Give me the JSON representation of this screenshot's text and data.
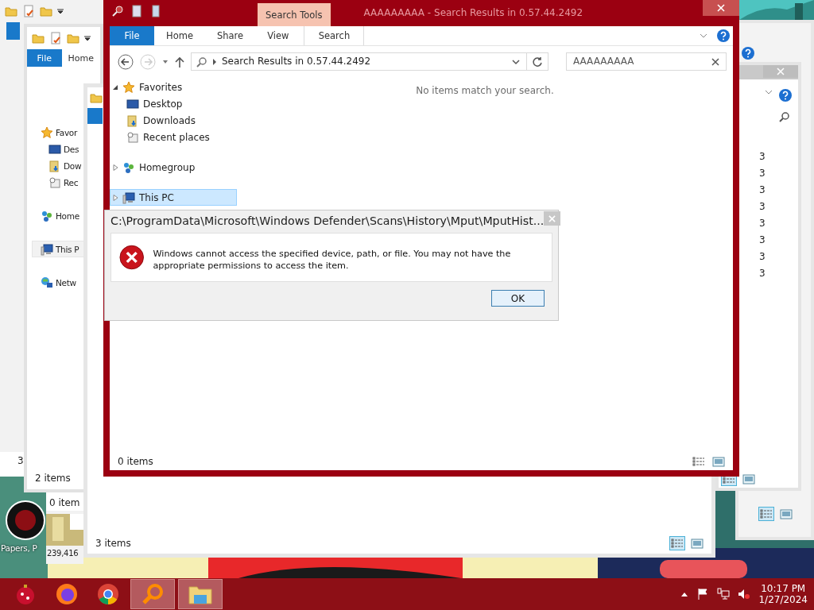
{
  "desktop": {
    "icon_label": "Papers, P"
  },
  "window_left": {
    "column_value": "3"
  },
  "window_behind": {
    "tabs": [
      {
        "label": "File",
        "selected": false
      },
      {
        "label": "Home",
        "selected": false
      }
    ],
    "nav_items": [
      {
        "label": "Favor",
        "kind": "favorites",
        "selected": false
      },
      {
        "label": "Des",
        "kind": "desktop",
        "selected": false
      },
      {
        "label": "Dow",
        "kind": "downloads",
        "selected": false
      },
      {
        "label": "Rec",
        "kind": "recent",
        "selected": false
      },
      {
        "label": "Home",
        "kind": "homegroup",
        "selected": false
      },
      {
        "label": "This P",
        "kind": "pc",
        "selected": true
      },
      {
        "label": "Netw",
        "kind": "network",
        "selected": false
      }
    ],
    "status": "2 items"
  },
  "small_window": {
    "status": "0 item",
    "size": "239,416"
  },
  "window_middle": {
    "status": "3 items"
  },
  "window_right": {
    "column_values": [
      "3",
      "3",
      "3",
      "3",
      "3",
      "3",
      "3",
      "3"
    ]
  },
  "main_window": {
    "title": "AAAAAAAAA - Search Results in 0.57.44.2492",
    "contextual_tab": "Search Tools",
    "tabs": [
      {
        "label": "File",
        "selected": false,
        "kind": "file"
      },
      {
        "label": "Home",
        "selected": false,
        "kind": "tab"
      },
      {
        "label": "Share",
        "selected": false,
        "kind": "tab"
      },
      {
        "label": "View",
        "selected": false,
        "kind": "tab"
      },
      {
        "label": "Search",
        "selected": true,
        "kind": "tab"
      }
    ],
    "address": "Search Results in 0.57.44.2492",
    "search": {
      "value": "AAAAAAAAA"
    },
    "nav_tree": [
      {
        "label": "Favorites",
        "kind": "favorites",
        "expanded": true,
        "selected": false,
        "children": [
          {
            "label": "Desktop",
            "kind": "desktop",
            "selected": false
          },
          {
            "label": "Downloads",
            "kind": "downloads",
            "selected": false
          },
          {
            "label": "Recent places",
            "kind": "recent",
            "selected": false
          }
        ]
      },
      {
        "label": "Homegroup",
        "kind": "homegroup",
        "expanded": false,
        "selected": false
      },
      {
        "label": "This PC",
        "kind": "pc",
        "expanded": false,
        "selected": true
      }
    ],
    "empty_message": "No items match your search.",
    "status": "0 items"
  },
  "dialog": {
    "title": "C:\\ProgramData\\Microsoft\\Windows Defender\\Scans\\History\\Mput\\MputHist...",
    "message": "Windows cannot access the specified device, path, or file. You may not have the appropriate permissions to access the item.",
    "button": "OK"
  },
  "taskbar": {
    "apps": [
      {
        "kind": "ornament",
        "active": false
      },
      {
        "kind": "firefox",
        "active": false
      },
      {
        "kind": "chrome",
        "active": false
      },
      {
        "kind": "search",
        "active": true
      },
      {
        "kind": "explorer",
        "active": true
      }
    ],
    "time": "10:17 PM",
    "date": "1/27/2024"
  }
}
